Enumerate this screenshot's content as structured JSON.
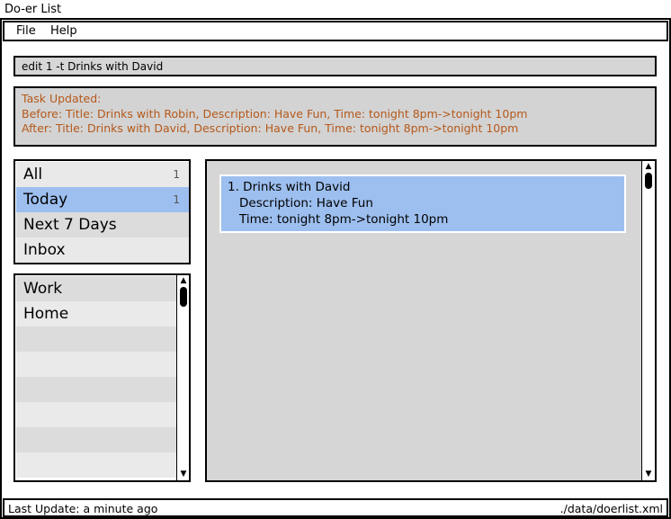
{
  "window": {
    "title": "Do-er List"
  },
  "menu": {
    "items": [
      {
        "label": "File"
      },
      {
        "label": "Help"
      }
    ]
  },
  "command": {
    "value": "edit 1 -t Drinks with David"
  },
  "result": {
    "lines": [
      "Task Updated:",
      "Before: Title: Drinks with Robin, Description: Have Fun, Time: tonight 8pm->tonight 10pm",
      "After: Title: Drinks with David, Description: Have Fun, Time: tonight 8pm->tonight 10pm"
    ],
    "color": "#b5581a"
  },
  "categories": [
    {
      "label": "All",
      "count": "1"
    },
    {
      "label": "Today",
      "count": "1",
      "selected": true
    },
    {
      "label": "Next 7 Days",
      "count": ""
    },
    {
      "label": "Inbox",
      "count": ""
    }
  ],
  "tags": [
    {
      "label": "Work"
    },
    {
      "label": "Home"
    }
  ],
  "tasks": [
    {
      "title": "1. Drinks with David",
      "description": "Description: Have Fun",
      "time": "Time: tonight 8pm->tonight 10pm"
    }
  ],
  "status": {
    "last_update": "Last Update: a minute ago",
    "file_path": "./data/doerlist.xml"
  },
  "colors": {
    "selected": "#9dbfef",
    "panel": "#d6d6d6",
    "row_light": "#e9e9e9",
    "row_dark": "#dcdcdc"
  },
  "icons": {
    "scroll_up": "scroll-up-arrow-icon",
    "scroll_down": "scroll-down-arrow-icon"
  }
}
